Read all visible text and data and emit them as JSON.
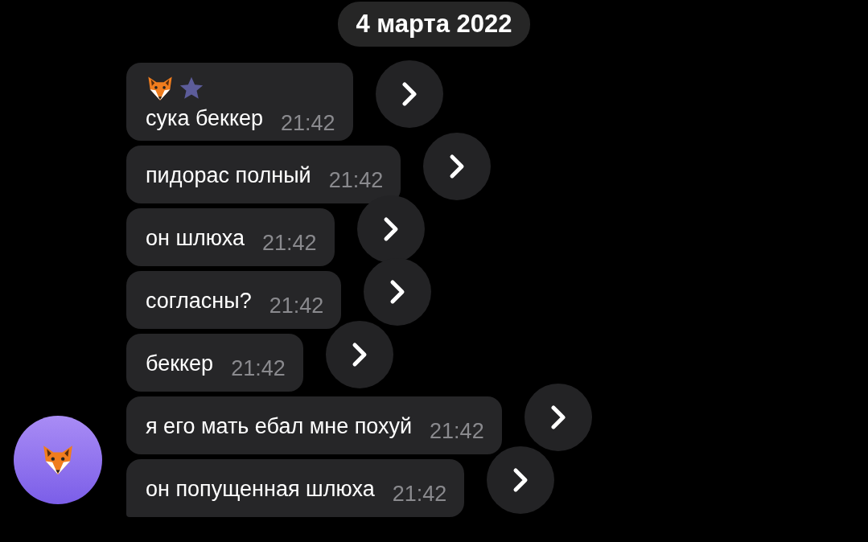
{
  "date": "4 марта 2022",
  "messages": [
    {
      "kind": "with-header",
      "text": "сука беккер",
      "time": "21:42"
    },
    {
      "kind": "plain",
      "text": "пидорас полный",
      "time": "21:42"
    },
    {
      "kind": "plain",
      "text": "он шлюха",
      "time": "21:42"
    },
    {
      "kind": "plain",
      "text": "согласны?",
      "time": "21:42"
    },
    {
      "kind": "plain",
      "text": "беккер",
      "time": "21:42"
    },
    {
      "kind": "plain",
      "text": "я его мать ебал мне похуй",
      "time": "21:42"
    },
    {
      "kind": "last",
      "text": "он попущенная шлюха",
      "time": "21:42"
    }
  ]
}
